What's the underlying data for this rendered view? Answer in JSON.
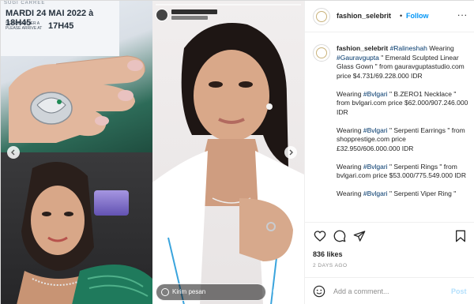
{
  "media": {
    "ticket": {
      "line1": "SUGI CARREE",
      "date": "MARDI 24 MAI 2022 à 18H45",
      "small": "SE PRESENTER A PLEASE ARRIVE AT",
      "time": "17H45"
    },
    "story_message_placeholder": "Kirim pesan",
    "icons": [
      "chevron-left-icon",
      "chevron-right-icon",
      "camera-icon",
      "heart-icon",
      "send-icon"
    ]
  },
  "post": {
    "username": "fashion_selebrit",
    "separator": "•",
    "follow_label": "Follow",
    "more_label": "...",
    "caption": {
      "username": "fashion_selebrit",
      "mention": "#Ralineshah",
      "intro": " Wearing ",
      "line1_tag": "#Gauravgupta",
      "line1_text": " \" Emerald Sculpted Linear Glass Gown \" from gauravguptastudio.com price $4.731/69.228.000 IDR",
      "line2_pre": "Wearing ",
      "line2_tag": "#Bvlgari",
      "line2_text": " \" B.ZERO1 Necklace \" from bvlgari.com price $62.000/907.246.000 IDR",
      "line3_pre": "Wearing ",
      "line3_tag": "#Bvlgari",
      "line3_text": " \" Serpenti Earrings \" from shopprestige.com price £32.950/606.000.000 IDR",
      "line4_pre": "Wearing ",
      "line4_tag": "#Bvlgari",
      "line4_text": " \" Serpenti Rings \" from bvlgari.com price $53.000/775.549.000 IDR",
      "line5_pre": "Wearing ",
      "line5_tag": "#Bvlgari",
      "line5_text": " \" Serpenti Viper Ring \""
    },
    "likes": "836 likes",
    "time_ago": "2 DAYS AGO",
    "comment_placeholder": "Add a comment...",
    "post_label": "Post"
  },
  "colors": {
    "accent": "#0095f6",
    "hashtag": "#00376b",
    "post_disabled": "#b2dffc",
    "muted": "#8e8e8e"
  }
}
